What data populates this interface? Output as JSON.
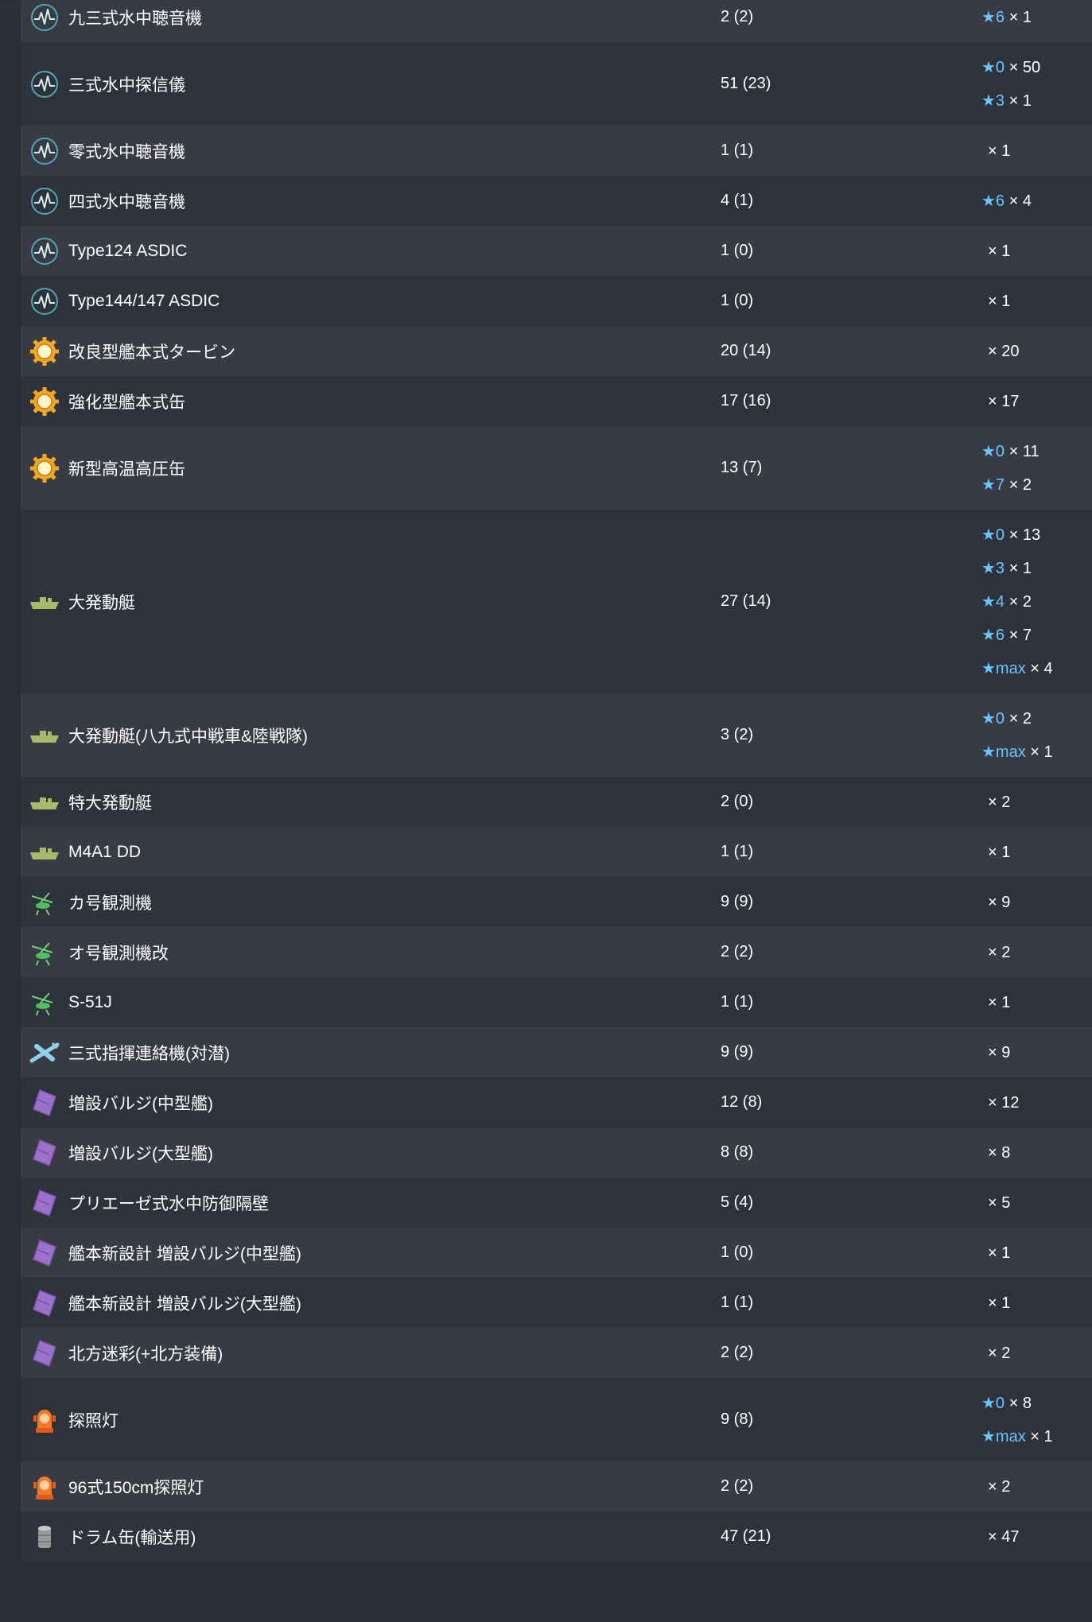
{
  "colors": {
    "star": "#67c5ff",
    "row_odd": "#383b44",
    "row_even": "#2e323b"
  },
  "rows": [
    {
      "icon": "sonar-icon",
      "name": "九三式水中聴音機",
      "count": "2 (2)",
      "stars": [
        {
          "star": "★6",
          "qty": "× 1"
        }
      ]
    },
    {
      "icon": "sonar-icon",
      "name": "三式水中探信儀",
      "count": "51 (23)",
      "stars": [
        {
          "star": "★0",
          "qty": "× 50"
        },
        {
          "star": "★3",
          "qty": "× 1"
        }
      ]
    },
    {
      "icon": "sonar-icon",
      "name": "零式水中聴音機",
      "count": "1 (1)",
      "stars": [
        {
          "star": "",
          "qty": "× 1"
        }
      ]
    },
    {
      "icon": "sonar-icon",
      "name": "四式水中聴音機",
      "count": "4 (1)",
      "stars": [
        {
          "star": "★6",
          "qty": "× 4"
        }
      ]
    },
    {
      "icon": "sonar-icon",
      "name": "Type124 ASDIC",
      "count": "1 (0)",
      "stars": [
        {
          "star": "",
          "qty": "× 1"
        }
      ]
    },
    {
      "icon": "sonar-icon",
      "name": "Type144/147 ASDIC",
      "count": "1 (0)",
      "stars": [
        {
          "star": "",
          "qty": "× 1"
        }
      ]
    },
    {
      "icon": "engine-icon",
      "name": "改良型艦本式タービン",
      "count": "20 (14)",
      "stars": [
        {
          "star": "",
          "qty": "× 20"
        }
      ]
    },
    {
      "icon": "engine-icon",
      "name": "強化型艦本式缶",
      "count": "17 (16)",
      "stars": [
        {
          "star": "",
          "qty": "× 17"
        }
      ]
    },
    {
      "icon": "engine-icon",
      "name": "新型高温高圧缶",
      "count": "13 (7)",
      "stars": [
        {
          "star": "★0",
          "qty": "× 11"
        },
        {
          "star": "★7",
          "qty": "× 2"
        }
      ]
    },
    {
      "icon": "landing-craft-icon",
      "name": "大発動艇",
      "count": "27 (14)",
      "stars": [
        {
          "star": "★0",
          "qty": "× 13"
        },
        {
          "star": "★3",
          "qty": "× 1"
        },
        {
          "star": "★4",
          "qty": "× 2"
        },
        {
          "star": "★6",
          "qty": "× 7"
        },
        {
          "star": "★max",
          "qty": "× 4"
        }
      ]
    },
    {
      "icon": "landing-craft-icon",
      "name": "大発動艇(八九式中戦車&陸戦隊)",
      "count": "3 (2)",
      "stars": [
        {
          "star": "★0",
          "qty": "× 2"
        },
        {
          "star": "★max",
          "qty": "× 1"
        }
      ]
    },
    {
      "icon": "landing-craft-icon",
      "name": "特大発動艇",
      "count": "2 (0)",
      "stars": [
        {
          "star": "",
          "qty": "× 2"
        }
      ]
    },
    {
      "icon": "landing-craft-icon",
      "name": "M4A1 DD",
      "count": "1 (1)",
      "stars": [
        {
          "star": "",
          "qty": "× 1"
        }
      ]
    },
    {
      "icon": "autogyro-icon",
      "name": "カ号観測機",
      "count": "9 (9)",
      "stars": [
        {
          "star": "",
          "qty": "× 9"
        }
      ]
    },
    {
      "icon": "autogyro-icon",
      "name": "オ号観測機改",
      "count": "2 (2)",
      "stars": [
        {
          "star": "",
          "qty": "× 2"
        }
      ]
    },
    {
      "icon": "autogyro-icon",
      "name": "S-51J",
      "count": "1 (1)",
      "stars": [
        {
          "star": "",
          "qty": "× 1"
        }
      ]
    },
    {
      "icon": "liaison-plane-icon",
      "name": "三式指揮連絡機(対潜)",
      "count": "9 (9)",
      "stars": [
        {
          "star": "",
          "qty": "× 9"
        }
      ]
    },
    {
      "icon": "bulge-icon",
      "name": "増設バルジ(中型艦)",
      "count": "12 (8)",
      "stars": [
        {
          "star": "",
          "qty": "× 12"
        }
      ]
    },
    {
      "icon": "bulge-icon",
      "name": "増設バルジ(大型艦)",
      "count": "8 (8)",
      "stars": [
        {
          "star": "",
          "qty": "× 8"
        }
      ]
    },
    {
      "icon": "bulge-icon",
      "name": "プリエーゼ式水中防御隔壁",
      "count": "5 (4)",
      "stars": [
        {
          "star": "",
          "qty": "× 5"
        }
      ]
    },
    {
      "icon": "bulge-icon",
      "name": "艦本新設計 増設バルジ(中型艦)",
      "count": "1 (0)",
      "stars": [
        {
          "star": "",
          "qty": "× 1"
        }
      ]
    },
    {
      "icon": "bulge-icon",
      "name": "艦本新設計 増設バルジ(大型艦)",
      "count": "1 (1)",
      "stars": [
        {
          "star": "",
          "qty": "× 1"
        }
      ]
    },
    {
      "icon": "bulge-icon",
      "name": "北方迷彩(+北方装備)",
      "count": "2 (2)",
      "stars": [
        {
          "star": "",
          "qty": "× 2"
        }
      ]
    },
    {
      "icon": "searchlight-icon",
      "name": "探照灯",
      "count": "9 (8)",
      "stars": [
        {
          "star": "★0",
          "qty": "× 8"
        },
        {
          "star": "★max",
          "qty": "× 1"
        }
      ]
    },
    {
      "icon": "searchlight-icon",
      "name": "96式150cm探照灯",
      "count": "2 (2)",
      "stars": [
        {
          "star": "",
          "qty": "× 2"
        }
      ]
    },
    {
      "icon": "drum-icon",
      "name": "ドラム缶(輸送用)",
      "count": "47 (21)",
      "stars": [
        {
          "star": "",
          "qty": "× 47"
        }
      ]
    }
  ]
}
